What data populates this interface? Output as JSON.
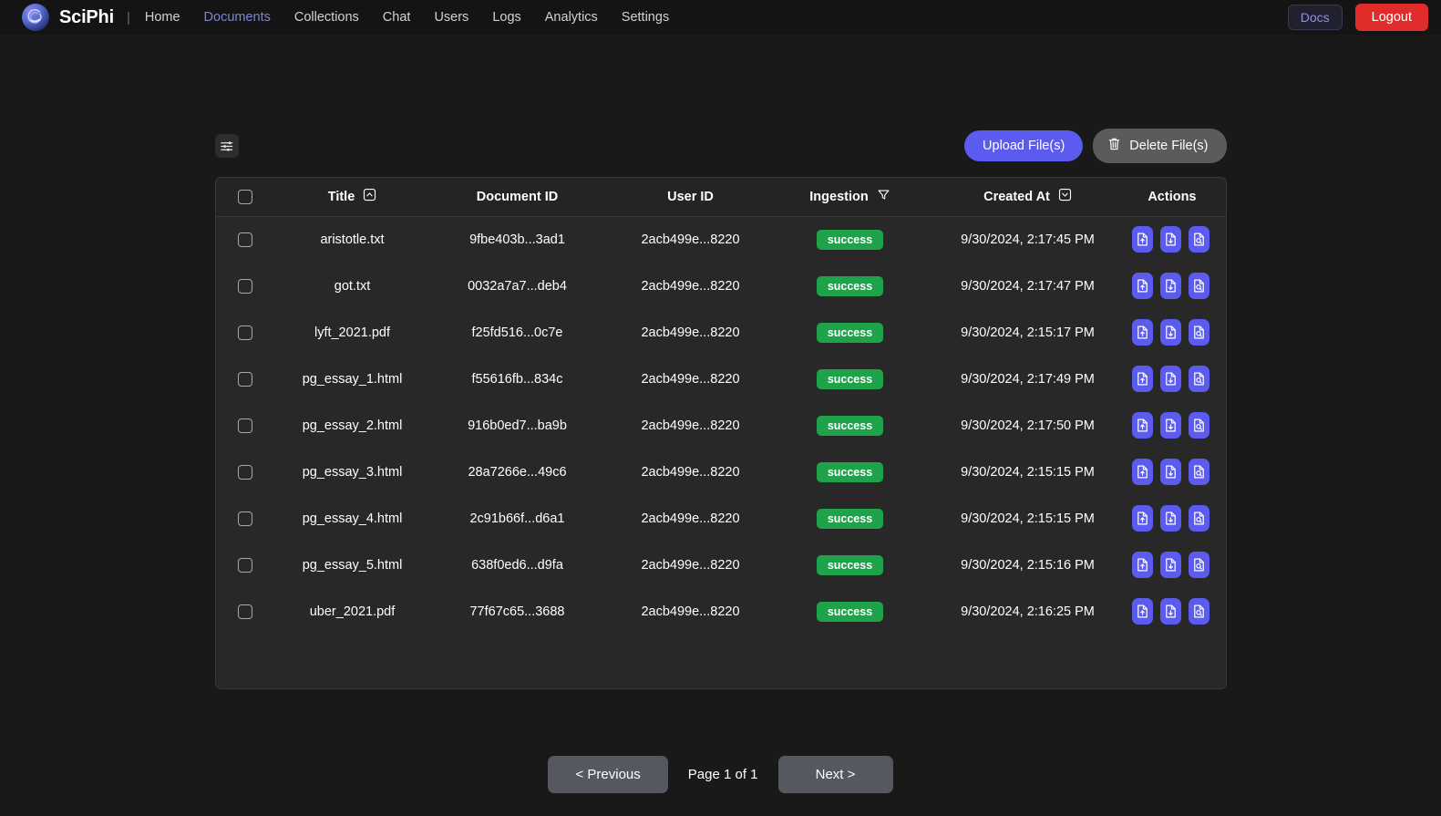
{
  "navbar": {
    "logo_icon": "sciphi-swirl-logo-icon",
    "brand": "SciPhi",
    "separator": "|",
    "links": [
      {
        "label": "Home",
        "active": false
      },
      {
        "label": "Documents",
        "active": true
      },
      {
        "label": "Collections",
        "active": false
      },
      {
        "label": "Chat",
        "active": false
      },
      {
        "label": "Users",
        "active": false
      },
      {
        "label": "Logs",
        "active": false
      },
      {
        "label": "Analytics",
        "active": false
      },
      {
        "label": "Settings",
        "active": false
      }
    ],
    "docs_label": "Docs",
    "logout_label": "Logout"
  },
  "toolbar": {
    "filter_icon": "sliders-settings-icon",
    "upload_label": "Upload File(s)",
    "delete_label": "Delete File(s)",
    "delete_icon": "trash-icon"
  },
  "table": {
    "headers": {
      "select_all": "",
      "title": "Title",
      "title_sort_icon": "sort-ascending-icon",
      "document_id": "Document ID",
      "user_id": "User ID",
      "ingestion": "Ingestion",
      "ingestion_filter_icon": "funnel-filter-icon",
      "created_at": "Created At",
      "created_at_sort_icon": "sort-descending-boxed-icon",
      "actions": "Actions"
    },
    "rows": [
      {
        "title": "aristotle.txt",
        "document_id": "9fbe403b...3ad1",
        "user_id": "2acb499e...8220",
        "ingestion": "success",
        "created_at": "9/30/2024, 2:17:45 PM"
      },
      {
        "title": "got.txt",
        "document_id": "0032a7a7...deb4",
        "user_id": "2acb499e...8220",
        "ingestion": "success",
        "created_at": "9/30/2024, 2:17:47 PM"
      },
      {
        "title": "lyft_2021.pdf",
        "document_id": "f25fd516...0c7e",
        "user_id": "2acb499e...8220",
        "ingestion": "success",
        "created_at": "9/30/2024, 2:15:17 PM"
      },
      {
        "title": "pg_essay_1.html",
        "document_id": "f55616fb...834c",
        "user_id": "2acb499e...8220",
        "ingestion": "success",
        "created_at": "9/30/2024, 2:17:49 PM"
      },
      {
        "title": "pg_essay_2.html",
        "document_id": "916b0ed7...ba9b",
        "user_id": "2acb499e...8220",
        "ingestion": "success",
        "created_at": "9/30/2024, 2:17:50 PM"
      },
      {
        "title": "pg_essay_3.html",
        "document_id": "28a7266e...49c6",
        "user_id": "2acb499e...8220",
        "ingestion": "success",
        "created_at": "9/30/2024, 2:15:15 PM"
      },
      {
        "title": "pg_essay_4.html",
        "document_id": "2c91b66f...d6a1",
        "user_id": "2acb499e...8220",
        "ingestion": "success",
        "created_at": "9/30/2024, 2:15:15 PM"
      },
      {
        "title": "pg_essay_5.html",
        "document_id": "638f0ed6...d9fa",
        "user_id": "2acb499e...8220",
        "ingestion": "success",
        "created_at": "9/30/2024, 2:15:16 PM"
      },
      {
        "title": "uber_2021.pdf",
        "document_id": "77f67c65...3688",
        "user_id": "2acb499e...8220",
        "ingestion": "success",
        "created_at": "9/30/2024, 2:16:25 PM"
      }
    ],
    "row_action_icons": [
      "file-upload-icon",
      "file-download-icon",
      "file-search-icon"
    ]
  },
  "pagination": {
    "previous_label": "< Previous",
    "page_label": "Page 1 of 1",
    "next_label": "Next >"
  },
  "colors": {
    "page_background": "#191919",
    "navbar_background": "#141414",
    "table_background": "#282828",
    "table_header_background": "#242424",
    "accent_indigo": "#5b5bf0",
    "active_link": "#7e83d8",
    "logout_red": "#e12c2c",
    "success_green": "#1ea34a",
    "button_gray": "#55585f"
  }
}
